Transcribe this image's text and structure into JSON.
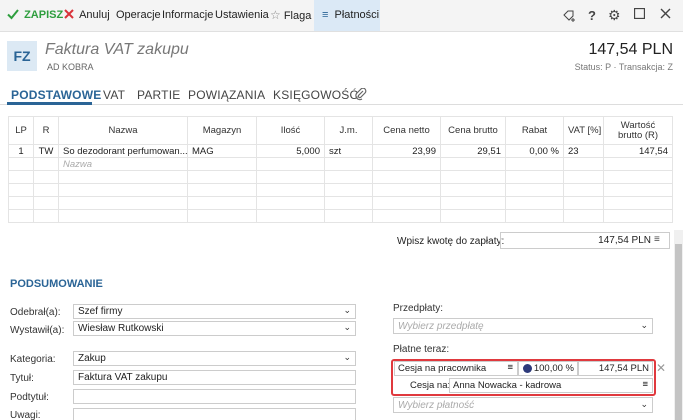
{
  "toolbar": {
    "save": "ZAPISZ",
    "cancel": "Anuluj",
    "operations": "Operacje",
    "information": "Informacje",
    "settings": "Ustawienia",
    "flag": "Flaga",
    "payments": "Płatności",
    "help": "?"
  },
  "header": {
    "badge": "FZ",
    "title": "Faktura VAT zakupu",
    "contractor": "AD KOBRA",
    "amount": "147,54 PLN",
    "status": "Status: P · Transakcja: Z"
  },
  "tabs": [
    "PODSTAWOWE",
    "VAT",
    "PARTIE",
    "POWIĄZANIA",
    "KSIĘGOWOŚĆ"
  ],
  "grid": {
    "columns": [
      "LP",
      "R",
      "Nazwa",
      "Magazyn",
      "Ilość",
      "J.m.",
      "Cena netto",
      "Cena brutto",
      "Rabat",
      "VAT [%]",
      "Wartość brutto (R)"
    ],
    "rows": [
      [
        "1",
        "TW",
        "So dezodorant perfumowan...",
        "MAG",
        "5,000",
        "szt",
        "23,99",
        "29,51",
        "0,00 %",
        "23",
        "147,54"
      ]
    ],
    "new_row_placeholder": "Nazwa"
  },
  "payment_sum": {
    "label": "Wpisz kwotę do zapłaty:",
    "value": "147,54 PLN"
  },
  "summary": {
    "title": "PODSUMOWANIE",
    "received_label": "Odebrał(a):",
    "received_value": "Szef firmy",
    "issued_label": "Wystawił(a):",
    "issued_value": "Wiesław Rutkowski",
    "category_label": "Kategoria:",
    "category_value": "Zakup",
    "title_label": "Tytuł:",
    "title_value": "Faktura VAT zakupu",
    "subtitle_label": "Podtytuł:",
    "subtitle_value": "",
    "notes_label": "Uwagi:"
  },
  "payments": {
    "prepayments_label": "Przedpłaty:",
    "prepayments_placeholder": "Wybierz przedpłatę",
    "pay_now_label": "Płatne teraz:",
    "method": "Cesja na pracownika",
    "percent": "100,00 %",
    "amount": "147,54 PLN",
    "assign_label": "Cesja na:",
    "assign_value": "Anna Nowacka - kadrowa",
    "choose_payment_placeholder": "Wybierz płatność"
  },
  "colors": {
    "accent": "#2a6496",
    "save_green": "#2e9e3e",
    "cancel_red": "#d9333a",
    "highlight_red": "#e0393e"
  }
}
